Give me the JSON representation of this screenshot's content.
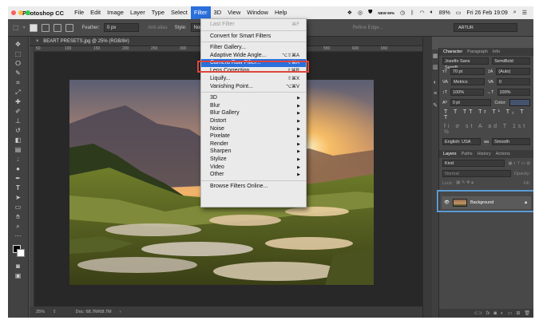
{
  "menubar": {
    "app_name": "Photoshop CC",
    "items": [
      "File",
      "Edit",
      "Image",
      "Layer",
      "Type",
      "Select",
      "Filter",
      "3D",
      "View",
      "Window",
      "Help"
    ],
    "active_item": "Filter",
    "battery": "89%",
    "datetime": "Fri 26 Feb  19:09",
    "tray_text": "NEW\n90%",
    "tray_label": "NEW 90%"
  },
  "options_bar": {
    "feather_label": "Feather:",
    "feather_value": "0 px",
    "anti_alias": "Anti-alias",
    "style_label": "Style:",
    "style_value": "Normal",
    "refine_edge": "Refine Edge...",
    "workspace": "ARTUR"
  },
  "document": {
    "tab_title": "BEART PRESETS.jpg @ 25% (RGB/8#)",
    "ruler_ticks": [
      "50",
      "100",
      "150",
      "200",
      "250",
      "300",
      "350",
      "400",
      "450",
      "500",
      "550",
      "600",
      "650"
    ],
    "zoom": "25%",
    "doc_size": "Doc: 68.7M/68.7M"
  },
  "filter_menu": {
    "items": [
      {
        "label": "Last Filter",
        "shortcut": "⌘F",
        "dim": true
      },
      {
        "sep": true
      },
      {
        "label": "Convert for Smart Filters"
      },
      {
        "sep": true
      },
      {
        "label": "Filter Gallery..."
      },
      {
        "label": "Adaptive Wide Angle...",
        "shortcut": "⌥⇧⌘A"
      },
      {
        "label": "Camera Raw Filter...",
        "shortcut": "⇧⌘A",
        "highlight": true
      },
      {
        "label": "Lens Correction...",
        "shortcut": "⇧⌘R"
      },
      {
        "label": "Liquify...",
        "shortcut": "⇧⌘X"
      },
      {
        "label": "Vanishing Point...",
        "shortcut": "⌥⌘V"
      },
      {
        "sep": true
      },
      {
        "label": "3D",
        "submenu": true
      },
      {
        "label": "Blur",
        "submenu": true
      },
      {
        "label": "Blur Gallery",
        "submenu": true
      },
      {
        "label": "Distort",
        "submenu": true
      },
      {
        "label": "Noise",
        "submenu": true
      },
      {
        "label": "Pixelate",
        "submenu": true
      },
      {
        "label": "Render",
        "submenu": true
      },
      {
        "label": "Sharpen",
        "submenu": true
      },
      {
        "label": "Stylize",
        "submenu": true
      },
      {
        "label": "Video",
        "submenu": true
      },
      {
        "label": "Other",
        "submenu": true
      },
      {
        "sep": true
      },
      {
        "label": "Browse Filters Online..."
      }
    ]
  },
  "character_panel": {
    "tabs": [
      "Character",
      "Paragraph",
      "Info"
    ],
    "font_family": "Josefin Sans SemiB...",
    "font_style": "SemiBold",
    "font_size": "70 pt",
    "leading": "(Auto)",
    "kerning": "Metrics",
    "tracking": "0",
    "vertical_scale": "100%",
    "horizontal_scale": "100%",
    "baseline_shift": "0 pt",
    "color_label": "Color:",
    "glyph_row_1": "T T TT Tr T¹ T₁ T T",
    "glyph_row_2": "fi ơ st A ad T 1st ½",
    "language": "English: USA",
    "aa_icon": "aa",
    "antialias": "Smooth"
  },
  "layers_panel": {
    "tabs": [
      "Layers",
      "Paths",
      "History",
      "Actions"
    ],
    "kind_label": "Kind",
    "blend_mode": "Normal",
    "opacity_label": "Opacity:",
    "lock_label": "Lock:",
    "fill_label": "Fill:",
    "layer_name": "Background"
  },
  "colors": {
    "menu_highlight": "#2a6fdb",
    "red_annotation": "#e0443a",
    "blue_annotation": "#5b9bd5"
  }
}
